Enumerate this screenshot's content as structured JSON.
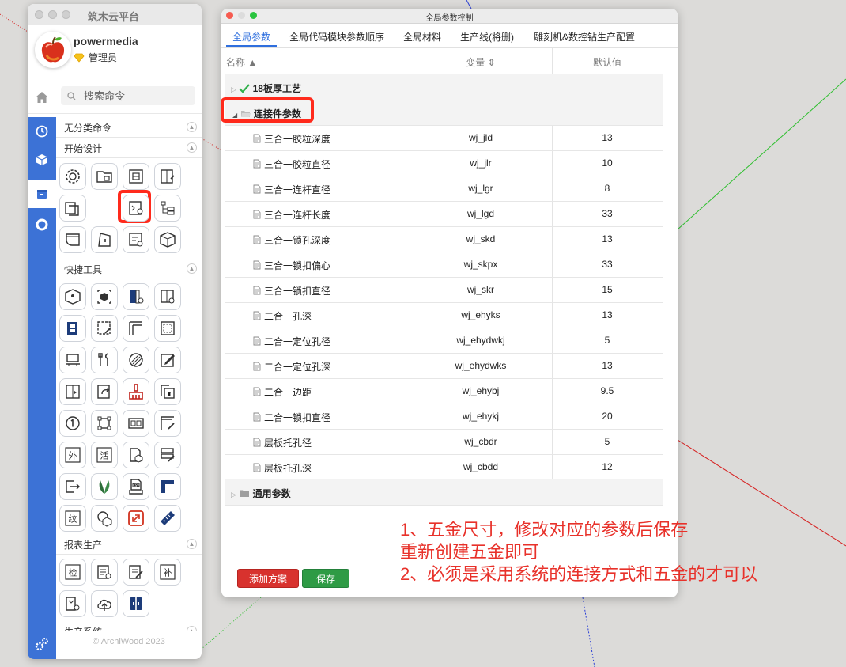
{
  "colors": {
    "accent": "#2f6fde",
    "sidebar": "#3c72d6",
    "highlight": "#ff2a1c",
    "annotation": "#e8312a",
    "add_btn": "#d8322e",
    "save_btn": "#2e9b45"
  },
  "left_panel": {
    "title": "筑木云平台",
    "user": {
      "name": "powermedia",
      "role": "管理员"
    },
    "search_placeholder": "搜索命令",
    "sections": [
      {
        "label": "无分类命令"
      },
      {
        "label": "开始设计"
      },
      {
        "label": "快捷工具"
      },
      {
        "label": "报表生产"
      },
      {
        "label": "生产系统"
      }
    ],
    "sidebar_icons": [
      "clock-icon",
      "cube-icon",
      "box-icon",
      "circle-icon"
    ],
    "copyright": "© ArchiWood 2023"
  },
  "dialog": {
    "title": "全局参数控制",
    "tabs": [
      {
        "label": "全局参数",
        "active": true
      },
      {
        "label": "全局代码模块参数顺序"
      },
      {
        "label": "全局材料"
      },
      {
        "label": "生产线(将删)"
      },
      {
        "label": "雕刻机&数控钻生产配置"
      }
    ],
    "headers": {
      "name": "名称 ▲",
      "var": "变量 ⇕",
      "val": "默认值"
    },
    "groups": {
      "g1": "18板厚工艺",
      "g2": "连接件参数",
      "g3": "通用参数"
    },
    "rows": [
      {
        "name": "三合一胶粒深度",
        "var": "wj_jld",
        "val": "13"
      },
      {
        "name": "三合一胶粒直径",
        "var": "wj_jlr",
        "val": "10"
      },
      {
        "name": "三合一连杆直径",
        "var": "wj_lgr",
        "val": "8"
      },
      {
        "name": "三合一连杆长度",
        "var": "wj_lgd",
        "val": "33"
      },
      {
        "name": "三合一锁孔深度",
        "var": "wj_skd",
        "val": "13"
      },
      {
        "name": "三合一锁扣偏心",
        "var": "wj_skpx",
        "val": "33"
      },
      {
        "name": "三合一锁扣直径",
        "var": "wj_skr",
        "val": "15"
      },
      {
        "name": "二合一孔深",
        "var": "wj_ehyks",
        "val": "13"
      },
      {
        "name": "二合一定位孔径",
        "var": "wj_ehydwkj",
        "val": "5"
      },
      {
        "name": "二合一定位孔深",
        "var": "wj_ehydwks",
        "val": "13"
      },
      {
        "name": "二合一边距",
        "var": "wj_ehybj",
        "val": "9.5"
      },
      {
        "name": "二合一锁扣直径",
        "var": "wj_ehykj",
        "val": "20"
      },
      {
        "name": "层板托孔径",
        "var": "wj_cbdr",
        "val": "5"
      },
      {
        "name": "层板托孔深",
        "var": "wj_cbdd",
        "val": "12"
      }
    ],
    "buttons": {
      "add": "添加方案",
      "save": "保存"
    }
  },
  "annotation": {
    "line1": "1、五金尺寸，修改对应的参数后保存",
    "line2": "重新创建五金即可",
    "line3": "2、必须是采用系统的连接方式和五金的才可以"
  }
}
